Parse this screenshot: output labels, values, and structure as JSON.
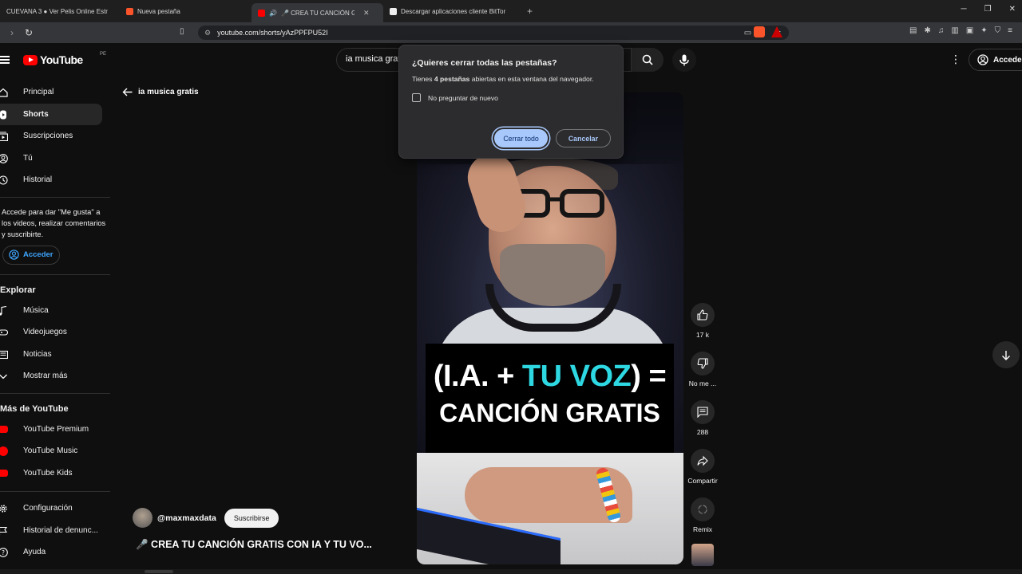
{
  "browser": {
    "tabs": [
      {
        "label": "CUEVANA 3 ● Ver Pelis Online Estr",
        "favicon_color": "#1a1a1a",
        "active": false
      },
      {
        "label": "Nueva pestaña",
        "favicon_color": "#fb542b",
        "active": false
      },
      {
        "label": "🎤 CREA TU CANCIÓN GRAT",
        "favicon_color": "#ff0000",
        "active": true
      },
      {
        "label": "Descargar aplicaciones cliente BitTor",
        "favicon_color": "#ffffff",
        "active": false
      }
    ],
    "new_tab_label": "+",
    "url": "youtube.com/shorts/yAzPPFPU52I",
    "extension_badge": "2"
  },
  "yt": {
    "logo_text": "YouTube",
    "country_code": "PE",
    "search_value": "ia musica gratis",
    "signin_label": "Acceder"
  },
  "sidebar": {
    "primary": [
      {
        "label": "Principal",
        "icon": "home-icon"
      },
      {
        "label": "Shorts",
        "icon": "shorts-icon",
        "active": true
      },
      {
        "label": "Suscripciones",
        "icon": "subscriptions-icon"
      },
      {
        "label": "Tú",
        "icon": "you-icon"
      },
      {
        "label": "Historial",
        "icon": "history-icon"
      }
    ],
    "signin_note": "Accede para dar \"Me gusta\" a los videos, realizar comentarios y suscribirte.",
    "signin_button": "Acceder",
    "explore_title": "Explorar",
    "explore": [
      {
        "label": "Música",
        "icon": "music-icon"
      },
      {
        "label": "Videojuegos",
        "icon": "gaming-icon"
      },
      {
        "label": "Noticias",
        "icon": "news-icon"
      },
      {
        "label": "Mostrar más",
        "icon": "chevron-down-icon"
      }
    ],
    "more_title": "Más de YouTube",
    "more": [
      {
        "label": "YouTube Premium"
      },
      {
        "label": "YouTube Music"
      },
      {
        "label": "YouTube Kids"
      }
    ],
    "settings": [
      {
        "label": "Configuración",
        "icon": "gear-icon"
      },
      {
        "label": "Historial de denunc...",
        "icon": "flag-icon"
      },
      {
        "label": "Ayuda",
        "icon": "help-icon"
      }
    ]
  },
  "main": {
    "back_label": "ia musica gratis",
    "video_caption_line1_a": "(I.A. + ",
    "video_caption_line1_b": "TU VOZ",
    "video_caption_line1_c": ") =",
    "video_caption_line2": "CANCIÓN GRATIS",
    "channel_handle": "@maxmaxdata",
    "subscribe_label": "Suscribirse",
    "video_title": "🎤 CREA TU CANCIÓN GRATIS CON IA Y TU VO..."
  },
  "rail": {
    "like_count": "17 k",
    "dislike_label": "No me ...",
    "comment_count": "288",
    "share_label": "Compartir",
    "remix_label": "Remix"
  },
  "dialog": {
    "title": "¿Quieres cerrar todas las pestañas?",
    "body_prefix": "Tienes ",
    "body_bold": "4 pestañas",
    "body_suffix": " abiertas en esta ventana del navegador.",
    "checkbox_label": "No preguntar de nuevo",
    "confirm_label": "Cerrar todo",
    "cancel_label": "Cancelar"
  }
}
